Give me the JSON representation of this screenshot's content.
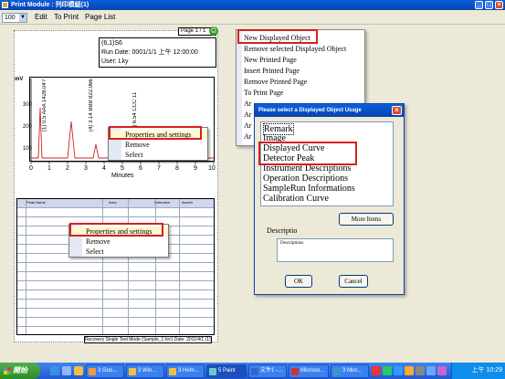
{
  "window": {
    "title": "Print Module : 列印模組(1)"
  },
  "menubar": {
    "zoom_value": "100",
    "items": [
      "Edit",
      "To Print",
      "Page List"
    ]
  },
  "page": {
    "page_indicator": "Page 1 / 1",
    "info_lines": [
      "(6,1)S6",
      "Run Date: 0001/1/1 上午 12:00:00",
      "User: Lky"
    ],
    "chart": {
      "ylabel": "mV",
      "y_ticks": [
        "100",
        "200",
        "300"
      ],
      "x_ticks": [
        "0",
        "1",
        "2",
        "3",
        "4",
        "5",
        "6",
        "7",
        "8",
        "9",
        "10"
      ],
      "xlabel": "Minutes",
      "peak_labels": [
        "(1) 0.5 AAA 1428.04?",
        "(4) 3.14 BBB 822.066",
        "(7) 6.54 CCC 11"
      ]
    },
    "table_headers": [
      "Peak Name",
      "Area",
      "",
      "Retention",
      "Area%"
    ],
    "footer_text": "Recovery Single Test Mode (Sample_1.hrc) Date: 2011/4/1 (1)"
  },
  "chart_context_menu": {
    "items": [
      "Properties and settings",
      "Remove",
      "Select"
    ]
  },
  "table_context_menu": {
    "items": [
      "Properties and settings",
      "Remove",
      "Select"
    ]
  },
  "main_context_menu": {
    "items": [
      "New Displayed Object",
      "Remove selected Displayed Object",
      "New Printed Page",
      "Insert Printed Page",
      "Remove Printed Page",
      "To Print Page",
      "Ar",
      "Ar",
      "Ar",
      "Ar"
    ]
  },
  "dialog": {
    "title": "Please select a Displayed Object Usage",
    "list_items": [
      "Remark",
      "Image",
      "Displayed Curve",
      "Detector Peak",
      "Instrument Descriptions",
      "Operation Descriptions",
      "SampleRun Informations",
      "Calibration Curve"
    ],
    "more_button": "More Items",
    "description_label": "Descriptio",
    "description_value": "Descriptions",
    "ok_button": "OK",
    "cancel_button": "Cancel"
  },
  "taskbar": {
    "start_label": "開始",
    "tasks": [
      "3 Goo...",
      "3 Win...",
      "3 Hom...",
      "5 Paint",
      "文件1 -...",
      "Microso...",
      "3 Micr..."
    ],
    "clock": "上午 10:29"
  },
  "colors": {
    "highlight_red": "#d42020",
    "titlebar_blue": "#0842b0",
    "curve_red": "#cc2222"
  }
}
